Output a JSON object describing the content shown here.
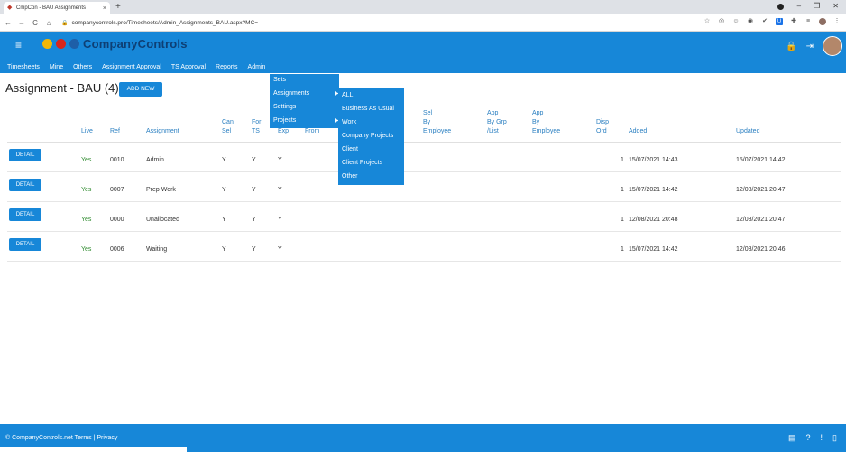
{
  "browser": {
    "tab_title": "CmpCon - BAU Assignments",
    "tab_close": "×",
    "new_tab": "+",
    "url": "companycontrols.pro/Timesheets/Admin_Assignments_BAU.aspx?MC=",
    "back": "←",
    "forward": "→",
    "reload": "C",
    "home": "⌂",
    "lock": "🔒",
    "star": "☆",
    "minimize": "–",
    "maximize": "❐",
    "close": "✕"
  },
  "app": {
    "brand": "CompanyControls",
    "hamburger": "≡",
    "menu": [
      "Timesheets",
      "Mine",
      "Others",
      "Assignment Approval",
      "TS Approval",
      "Reports",
      "Admin"
    ],
    "lock_icon": "lock-icon",
    "logout_icon": "logout-icon"
  },
  "page": {
    "title": "Assignment - BAU (4) -",
    "add_new": "ADD NEW"
  },
  "table": {
    "headers": {
      "live": "Live",
      "ref": "Ref",
      "assignment": "Assignment",
      "can_sel_1": "Can",
      "can_sel_2": "Sel",
      "for_ts_1": "For",
      "for_ts_2": "TS",
      "exp": "Exp",
      "from": "From",
      "sel_emp_1": "Sel",
      "sel_emp_2": "By",
      "sel_emp_3": "Employee",
      "app_grp_1": "App",
      "app_grp_2": "By Grp",
      "app_grp_3": "/List",
      "app_emp_1": "App",
      "app_emp_2": "By",
      "app_emp_3": "Employee",
      "disp_ord_1": "Disp",
      "disp_ord_2": "Ord",
      "added": "Added",
      "updated": "Updated"
    },
    "detail_label": "DETAIL",
    "rows": [
      {
        "live": "Yes",
        "ref": "0010",
        "assignment": "Admin",
        "can_sel": "Y",
        "for_ts": "Y",
        "exp": "Y",
        "disp_ord": "1",
        "added": "15/07/2021 14:43",
        "updated": "15/07/2021 14:42"
      },
      {
        "live": "Yes",
        "ref": "0007",
        "assignment": "Prep Work",
        "can_sel": "Y",
        "for_ts": "Y",
        "exp": "Y",
        "disp_ord": "1",
        "added": "15/07/2021 14:42",
        "updated": "12/08/2021 20:47"
      },
      {
        "live": "Yes",
        "ref": "0000",
        "assignment": "Unallocated",
        "can_sel": "Y",
        "for_ts": "Y",
        "exp": "Y",
        "disp_ord": "1",
        "added": "12/08/2021 20:48",
        "updated": "12/08/2021 20:47"
      },
      {
        "live": "Yes",
        "ref": "0006",
        "assignment": "Waiting",
        "can_sel": "Y",
        "for_ts": "Y",
        "exp": "Y",
        "disp_ord": "1",
        "added": "15/07/2021 14:42",
        "updated": "12/08/2021 20:46"
      }
    ]
  },
  "admin_dropdown": {
    "items": [
      "Sets",
      "Assignments",
      "Settings",
      "Projects"
    ]
  },
  "assignments_submenu": {
    "items": [
      "ALL",
      "Business As Usual",
      "Work",
      "Company Projects",
      "Client",
      "Client Projects",
      "Other"
    ]
  },
  "footer": {
    "text": "© CompanyControls.net Terms | Privacy"
  },
  "colors": {
    "brand_blue": "#1787d8",
    "live_green": "#2e8b2e",
    "header_text": "#2a7fc1"
  }
}
